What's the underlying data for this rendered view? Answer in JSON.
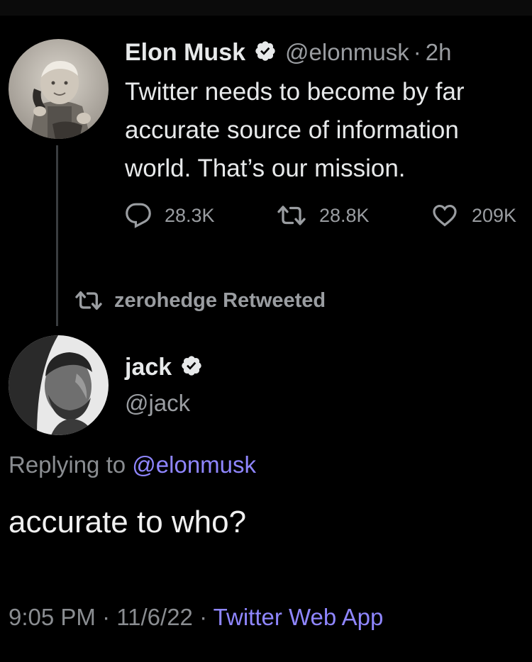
{
  "parent_tweet": {
    "author_name": "Elon Musk",
    "handle": "@elonmusk",
    "separator": "·",
    "age": "2h",
    "text_lines": [
      "Twitter needs to become by far",
      "accurate source of information",
      "world. That’s our mission."
    ],
    "actions": {
      "replies": "28.3K",
      "retweets": "28.8K",
      "likes": "209K"
    }
  },
  "retweet_banner": "zerohedge Retweeted",
  "reply_tweet": {
    "author_name": "jack",
    "handle": "@jack",
    "replying_prefix": "Replying to",
    "replying_handle": "@elonmusk",
    "text": "accurate to who?",
    "time": "9:05 PM",
    "date": "11/6/22",
    "sep": "·",
    "source": "Twitter Web App"
  },
  "colors": {
    "background": "#000000",
    "text": "#e7e9ea",
    "muted": "#9a9da1",
    "link": "#8f86ff"
  }
}
